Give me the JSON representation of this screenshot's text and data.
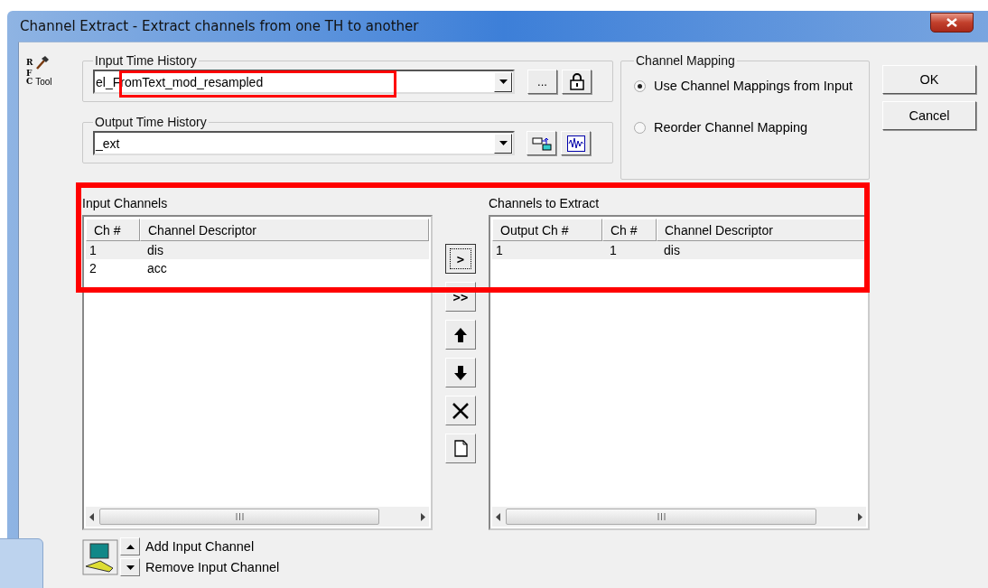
{
  "window": {
    "title": "Channel Extract - Extract channels from one TH to another"
  },
  "logo": {
    "letters": [
      "R",
      "F",
      "C"
    ],
    "caption": "Tool"
  },
  "input_time_history": {
    "label": "Input Time History",
    "value": "el_FromText_mod_resampled",
    "browse_label": "..."
  },
  "output_time_history": {
    "label": "Output Time History",
    "value": "_ext"
  },
  "channel_mapping": {
    "label": "Channel Mapping",
    "options": [
      {
        "label": "Use Channel Mappings from Input",
        "selected": true
      },
      {
        "label": "Reorder Channel Mapping",
        "selected": false
      }
    ]
  },
  "buttons": [
    "OK",
    "Cancel"
  ],
  "input_channels": {
    "label": "Input Channels",
    "columns": [
      "Ch #",
      "Channel Descriptor"
    ],
    "rows": [
      {
        "cells": [
          "1",
          "dis"
        ],
        "selected": true
      },
      {
        "cells": [
          "2",
          "acc"
        ],
        "selected": false
      }
    ]
  },
  "transfer_buttons": [
    {
      "kind": "text",
      "label": ">",
      "focused": true
    },
    {
      "kind": "text",
      "label": ">>",
      "focused": false
    },
    {
      "kind": "up",
      "focused": false
    },
    {
      "kind": "down",
      "focused": false
    },
    {
      "kind": "delete",
      "focused": false
    },
    {
      "kind": "new",
      "focused": false
    }
  ],
  "channels_to_extract": {
    "label": "Channels to Extract",
    "columns": [
      "Output Ch #",
      "Ch #",
      "Channel Descriptor"
    ],
    "rows": [
      {
        "cells": [
          "1",
          "1",
          "dis"
        ],
        "selected": true
      }
    ]
  },
  "channel_controls": [
    "Add Input Channel",
    "Remove Input Channel"
  ]
}
